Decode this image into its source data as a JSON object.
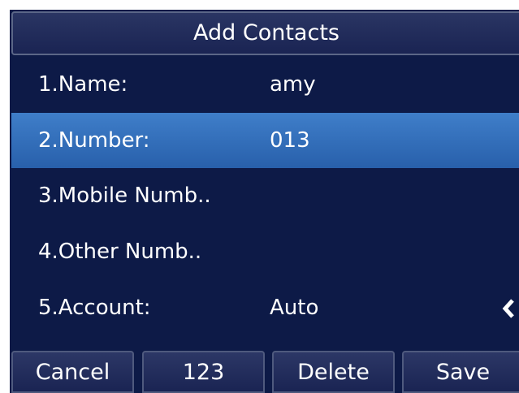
{
  "title": "Add Contacts",
  "fields": [
    {
      "label": "1.Name:",
      "value": "amy"
    },
    {
      "label": "2.Number:",
      "value": "013"
    },
    {
      "label": "3.Mobile Numb..",
      "value": ""
    },
    {
      "label": "4.Other Numb..",
      "value": ""
    },
    {
      "label": "5.Account:",
      "value": "Auto"
    }
  ],
  "selected_field": "2.Number:",
  "softkeys": {
    "cancel": "Cancel",
    "numeric_mode": "123",
    "delete": "Delete",
    "save": "Save"
  },
  "icons": {
    "account_selector": "left-right-arrows-icon"
  },
  "colors": {
    "background": "#0d1a47",
    "selection": "#3a78c3"
  }
}
